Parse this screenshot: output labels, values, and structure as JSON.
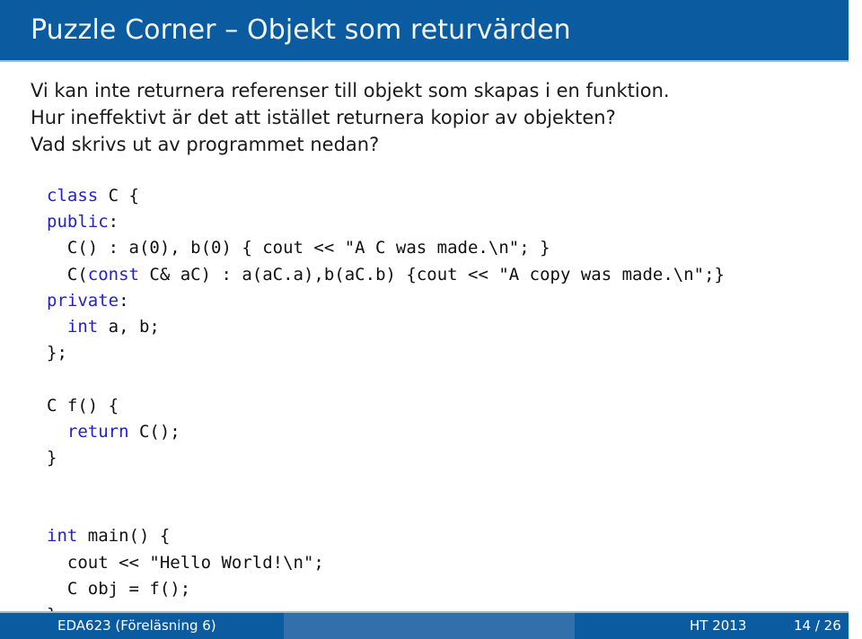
{
  "slide": {
    "title": "Puzzle Corner – Objekt som returvärden",
    "colors": {
      "header_blue": "#0a5ba0",
      "footer_light_blue": "#336fab",
      "rule_blue": "#9fbcd6",
      "keyword_blue": "#2222cc",
      "text_black": "#1a1a1a"
    }
  },
  "prose": {
    "lines": [
      "Vi kan inte returnera referenser till objekt som skapas i en funktion.",
      "Hur ineffektivt är det att istället returnera kopior av objekten?",
      "Vad skrivs ut av programmet nedan?"
    ]
  },
  "code": {
    "lines": [
      [
        {
          "t": "class",
          "k": true
        },
        {
          "t": " C {",
          "k": false
        }
      ],
      [
        {
          "t": "public",
          "k": true
        },
        {
          "t": ":",
          "k": false
        }
      ],
      [
        {
          "t": "  C() : a(0), b(0) { cout << \"A C was made.\\n\"; }",
          "k": false
        }
      ],
      [
        {
          "t": "  C(",
          "k": false
        },
        {
          "t": "const",
          "k": true
        },
        {
          "t": " C& aC) : a(aC.a),b(aC.b) {cout << \"A copy was made.\\n\";}",
          "k": false
        }
      ],
      [
        {
          "t": "private",
          "k": true
        },
        {
          "t": ":",
          "k": false
        }
      ],
      [
        {
          "t": "  ",
          "k": false
        },
        {
          "t": "int",
          "k": true
        },
        {
          "t": " a, b;",
          "k": false
        }
      ],
      [
        {
          "t": "};",
          "k": false
        }
      ],
      [
        {
          "t": "",
          "k": false
        }
      ],
      [
        {
          "t": "C f() {",
          "k": false
        }
      ],
      [
        {
          "t": "  ",
          "k": false
        },
        {
          "t": "return",
          "k": true
        },
        {
          "t": " C();",
          "k": false
        }
      ],
      [
        {
          "t": "}",
          "k": false
        }
      ],
      [
        {
          "t": "",
          "k": false
        }
      ],
      [
        {
          "t": "",
          "k": false
        }
      ],
      [
        {
          "t": "",
          "k": false
        },
        {
          "t": "int",
          "k": true
        },
        {
          "t": " main() {",
          "k": false
        }
      ],
      [
        {
          "t": "  cout << \"Hello World!\\n\";",
          "k": false
        }
      ],
      [
        {
          "t": "  C obj = f();",
          "k": false
        }
      ],
      [
        {
          "t": "}",
          "k": false
        }
      ]
    ]
  },
  "footer": {
    "course": "EDA623  (Föreläsning 6)",
    "term": "HT 2013",
    "page": "14 / 26"
  }
}
